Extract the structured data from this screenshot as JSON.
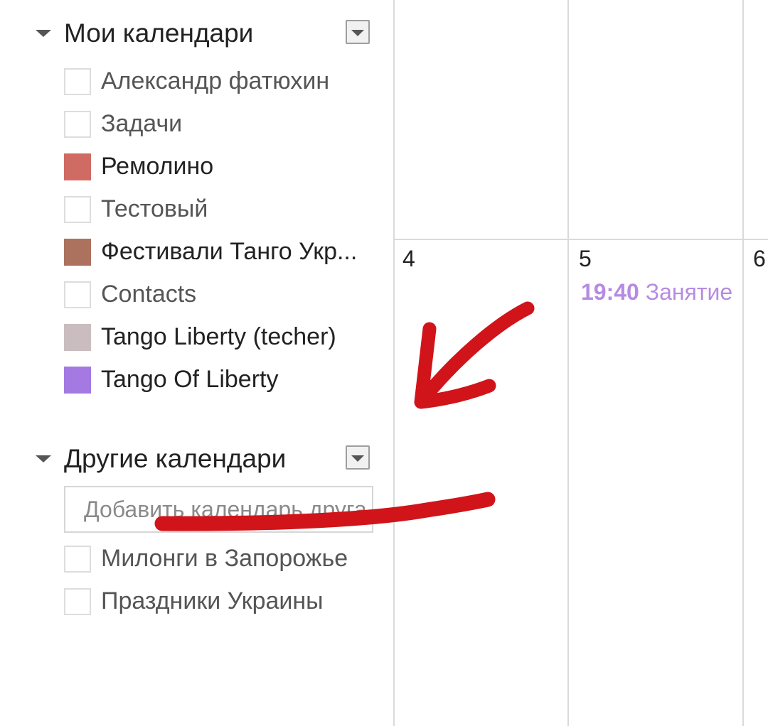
{
  "my_calendars": {
    "title": "Мои календари",
    "items": [
      {
        "label": "Александр фатюхин",
        "color": "",
        "checked": false
      },
      {
        "label": "Задачи",
        "color": "",
        "checked": false
      },
      {
        "label": "Ремолино",
        "color": "#d06b64",
        "checked": true
      },
      {
        "label": "Тестовый",
        "color": "",
        "checked": false
      },
      {
        "label": "Фестивали Танго Укр...",
        "color": "#ac725e",
        "checked": true
      },
      {
        "label": "Contacts",
        "color": "",
        "checked": false
      },
      {
        "label": "Tango Liberty (techer)",
        "color": "#cabdbf",
        "checked": true
      },
      {
        "label": "Tango Of Liberty",
        "color": "#a47ae2",
        "checked": true
      }
    ]
  },
  "other_calendars": {
    "title": "Другие календари",
    "add_placeholder": "Добавить календарь друга",
    "items": [
      {
        "label": "Милонги в Запорожье",
        "color": "",
        "checked": false
      },
      {
        "label": "Праздники Украины",
        "color": "",
        "checked": false
      }
    ]
  },
  "grid": {
    "days": [
      "4",
      "5",
      "6"
    ],
    "event": {
      "time": "19:40",
      "title": "Занятие",
      "color": "#b58be3"
    }
  },
  "annotation": {
    "color": "#d0141a"
  }
}
